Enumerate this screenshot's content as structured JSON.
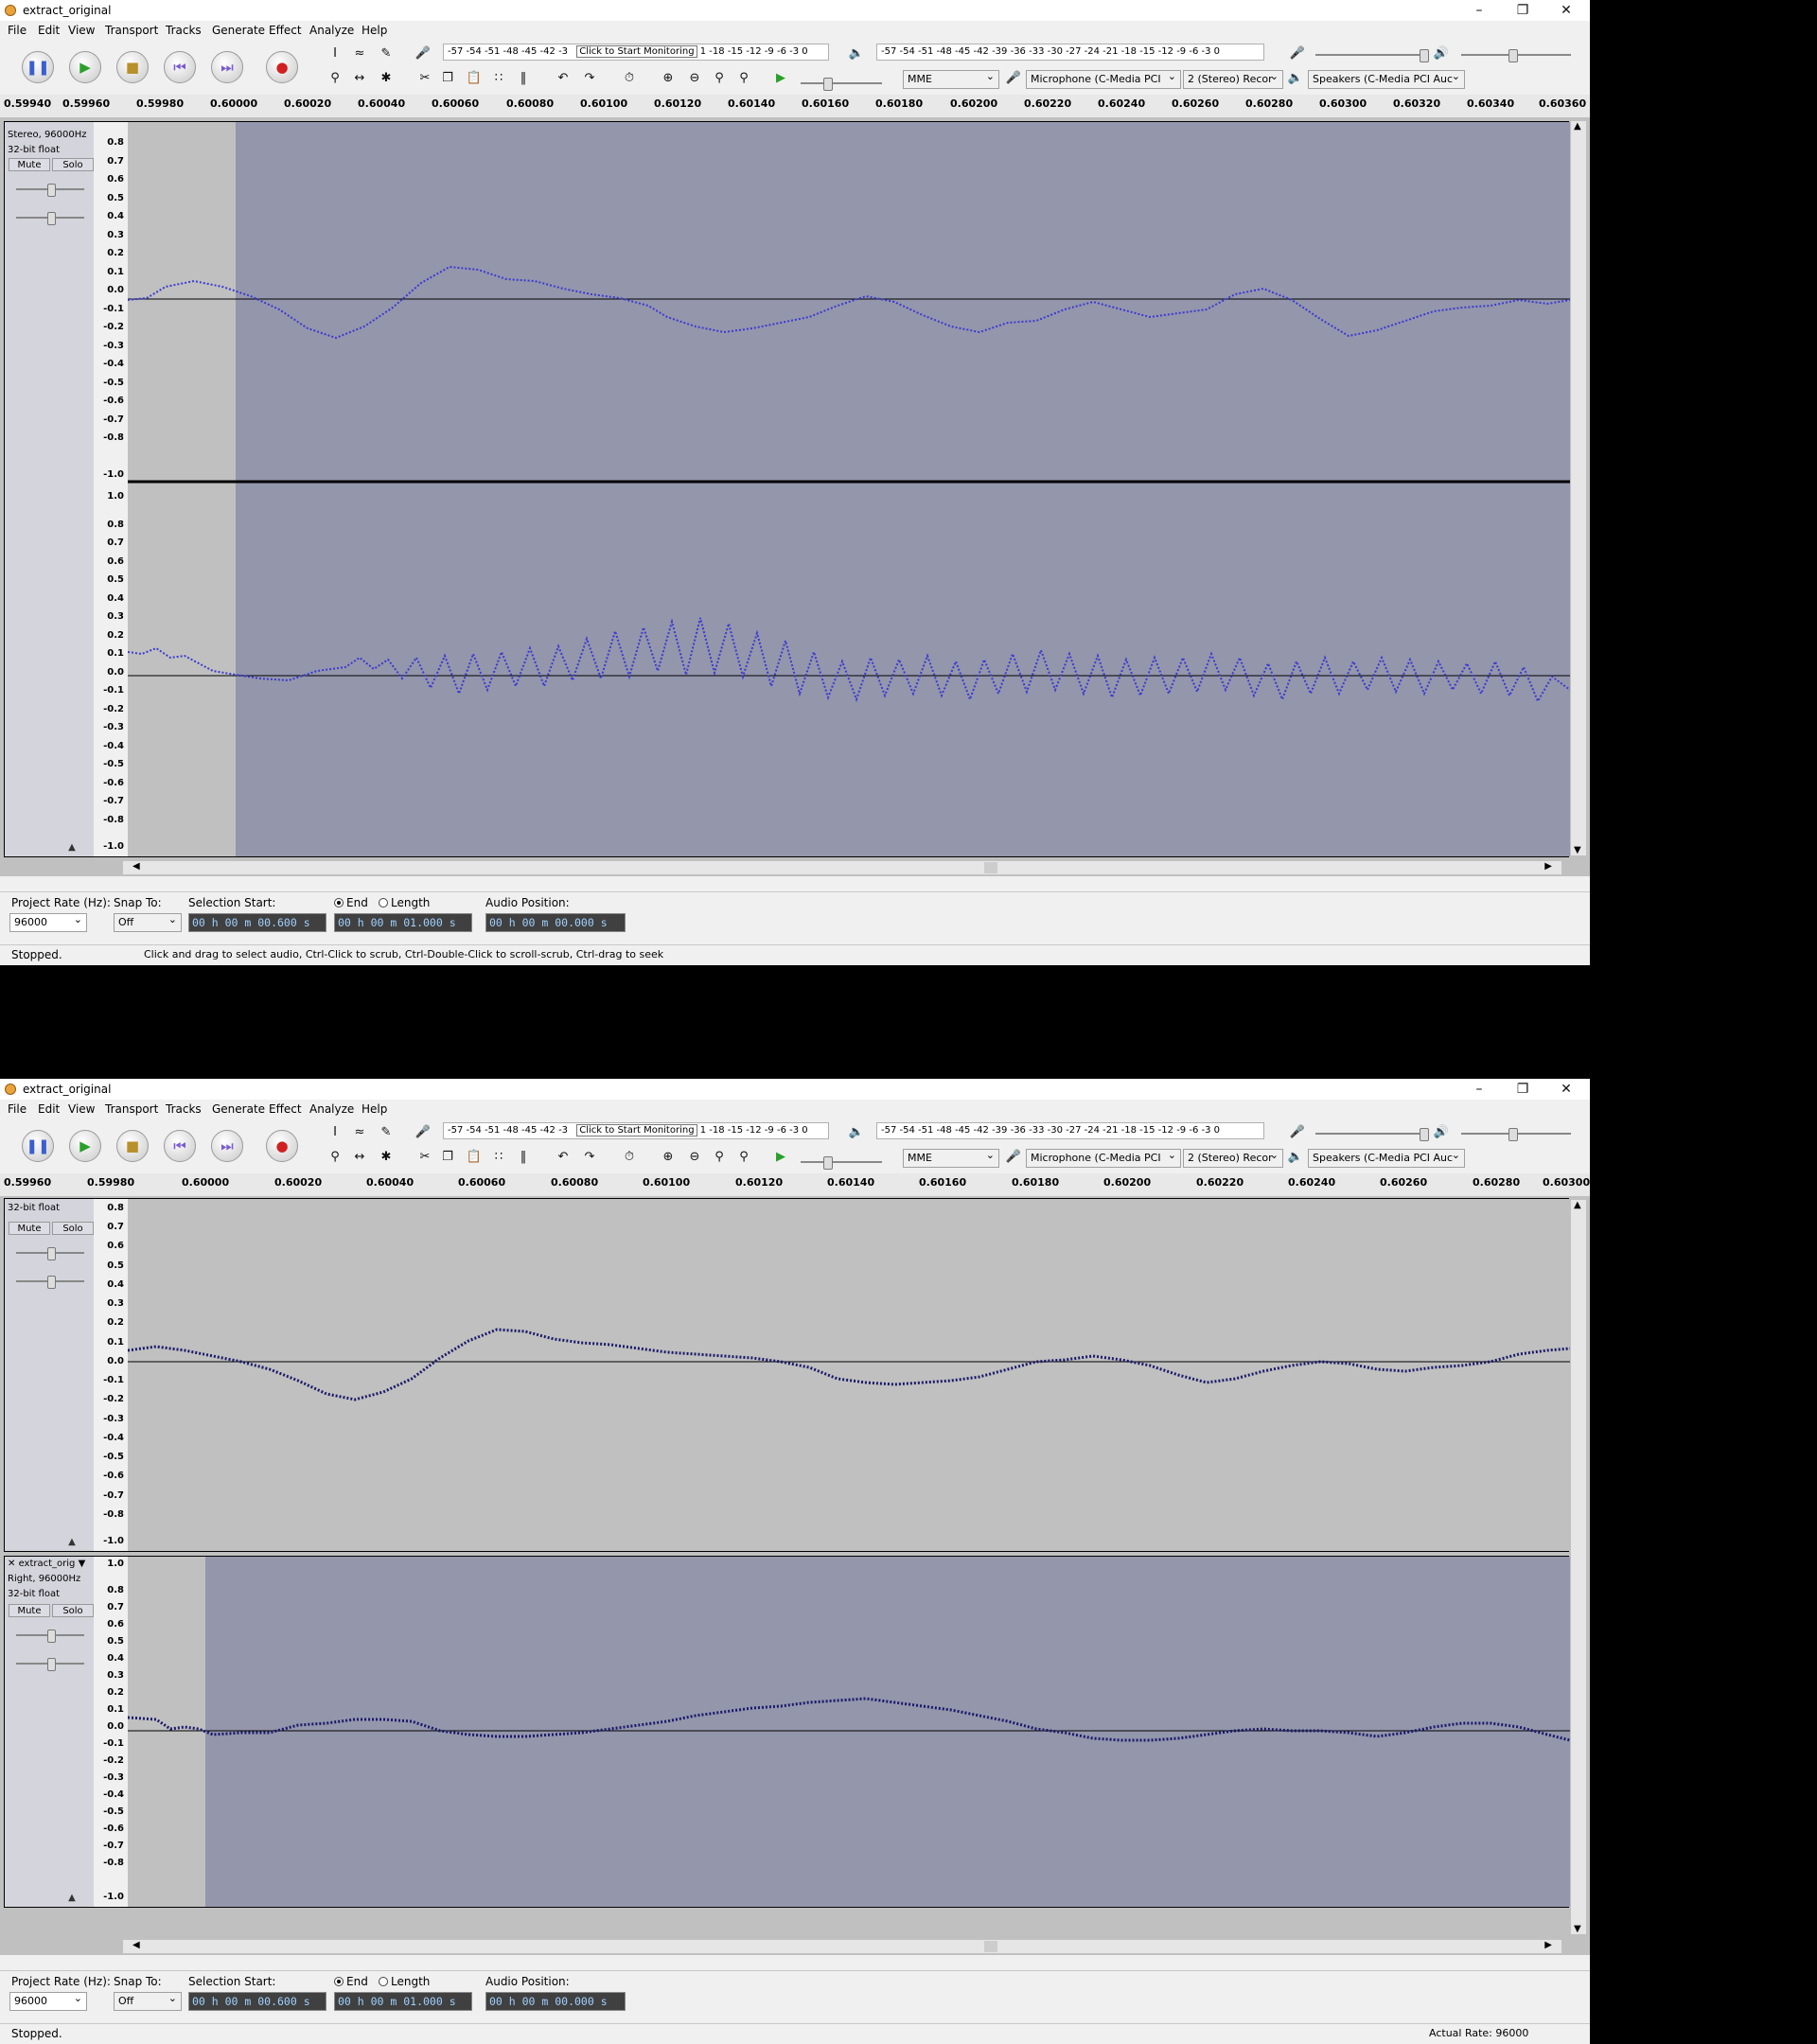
{
  "windows": [
    {
      "title": "extract_original",
      "menu": [
        "File",
        "Edit",
        "View",
        "Transport",
        "Tracks",
        "Generate",
        "Effect",
        "Analyze",
        "Help"
      ],
      "toolbar": {
        "record_meter": "-57 -54 -51 -48 -45 -42 -3",
        "record_hint": "Click to Start Monitoring",
        "record_meter_tail": "1 -18 -15 -12 -9 -6 -3 0",
        "play_meter": "-57 -54 -51 -48 -45 -42 -39 -36 -33 -30 -27 -24 -21 -18 -15 -12 -9 -6 -3 0",
        "host": "MME",
        "rec_device": "Microphone (C-Media PCI",
        "channels": "2 (Stereo) Recor",
        "play_device": "Speakers (C-Media PCI Auc"
      },
      "ruler": [
        "0.59940",
        "0.59960",
        "0.59980",
        "0.60000",
        "0.60020",
        "0.60040",
        "0.60060",
        "0.60080",
        "0.60100",
        "0.60120",
        "0.60140",
        "0.60160",
        "0.60180",
        "0.60200",
        "0.60220",
        "0.60240",
        "0.60260",
        "0.60280",
        "0.60300",
        "0.60320",
        "0.60340",
        "0.60360"
      ],
      "tracks": [
        {
          "info": [
            "Stereo, 96000Hz",
            "32-bit float"
          ],
          "mute": "Mute",
          "solo": "Solo",
          "scale": [
            "0.8",
            "0.7",
            "0.6",
            "0.5",
            "0.4",
            "0.3",
            "0.2",
            "0.1",
            "0.0",
            "-0.1",
            "-0.2",
            "-0.3",
            "-0.4",
            "-0.5",
            "-0.6",
            "-0.7",
            "-0.8",
            "-1.0"
          ]
        },
        {
          "info": [],
          "mute": "",
          "solo": "",
          "scale": [
            "1.0",
            "0.8",
            "0.7",
            "0.6",
            "0.5",
            "0.4",
            "0.3",
            "0.2",
            "0.1",
            "0.0",
            "-0.1",
            "-0.2",
            "-0.3",
            "-0.4",
            "-0.5",
            "-0.6",
            "-0.7",
            "-0.8",
            "-1.0"
          ]
        }
      ],
      "selection": {
        "rate_label": "Project Rate (Hz):",
        "rate": "96000",
        "snap_label": "Snap To:",
        "snap": "Off",
        "start_label": "Selection Start:",
        "start": "00 h 00 m 00.600 s",
        "end_label": "End",
        "length_label": "Length",
        "end": "00 h 00 m 01.000 s",
        "pos_label": "Audio Position:",
        "pos": "00 h 00 m 00.000 s"
      },
      "status": {
        "state": "Stopped.",
        "hint": "Click and drag to select audio, Ctrl-Click to scrub, Ctrl-Double-Click to scroll-scrub, Ctrl-drag to seek",
        "rate": ""
      }
    },
    {
      "title": "extract_original",
      "menu": [
        "File",
        "Edit",
        "View",
        "Transport",
        "Tracks",
        "Generate",
        "Effect",
        "Analyze",
        "Help"
      ],
      "toolbar": {
        "record_meter": "-57 -54 -51 -48 -45 -42 -3",
        "record_hint": "Click to Start Monitoring",
        "record_meter_tail": "1 -18 -15 -12 -9 -6 -3 0",
        "play_meter": "-57 -54 -51 -48 -45 -42 -39 -36 -33 -30 -27 -24 -21 -18 -15 -12 -9 -6 -3 0",
        "host": "MME",
        "rec_device": "Microphone (C-Media PCI",
        "channels": "2 (Stereo) Recor",
        "play_device": "Speakers (C-Media PCI Auc"
      },
      "ruler": [
        "0.59960",
        "0.59980",
        "0.60000",
        "0.60020",
        "0.60040",
        "0.60060",
        "0.60080",
        "0.60100",
        "0.60120",
        "0.60140",
        "0.60160",
        "0.60180",
        "0.60200",
        "0.60220",
        "0.60240",
        "0.60260",
        "0.60280",
        "0.60300"
      ],
      "tracks": [
        {
          "info": [
            "32-bit float"
          ],
          "mute": "Mute",
          "solo": "Solo",
          "scale": [
            "0.8",
            "0.7",
            "0.6",
            "0.5",
            "0.4",
            "0.3",
            "0.2",
            "0.1",
            "0.0",
            "-0.1",
            "-0.2",
            "-0.3",
            "-0.4",
            "-0.5",
            "-0.6",
            "-0.7",
            "-0.8",
            "-1.0"
          ]
        },
        {
          "info": [
            "extract_orig",
            "Right, 96000Hz",
            "32-bit float"
          ],
          "mute": "Mute",
          "solo": "Solo",
          "scale": [
            "1.0",
            "0.8",
            "0.7",
            "0.6",
            "0.5",
            "0.4",
            "0.3",
            "0.2",
            "0.1",
            "0.0",
            "-0.1",
            "-0.2",
            "-0.3",
            "-0.4",
            "-0.5",
            "-0.6",
            "-0.7",
            "-0.8",
            "-1.0"
          ]
        }
      ],
      "selection": {
        "rate_label": "Project Rate (Hz):",
        "rate": "96000",
        "snap_label": "Snap To:",
        "snap": "Off",
        "start_label": "Selection Start:",
        "start": "00 h 00 m 00.600 s",
        "end_label": "End",
        "length_label": "Length",
        "end": "00 h 00 m 01.000 s",
        "pos_label": "Audio Position:",
        "pos": "00 h 00 m 00.000 s"
      },
      "status": {
        "state": "Stopped.",
        "hint": "",
        "rate": "Actual Rate: 96000"
      }
    }
  ]
}
